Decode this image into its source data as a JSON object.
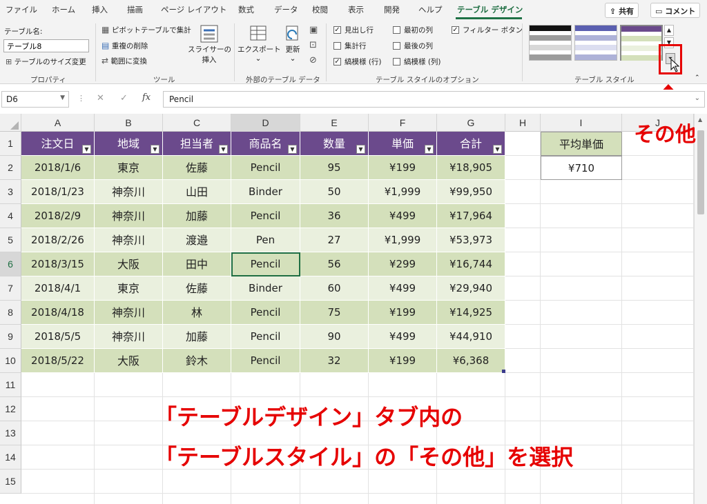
{
  "tabs": [
    "ファイル",
    "ホーム",
    "挿入",
    "描画",
    "ページ レイアウト",
    "数式",
    "データ",
    "校閲",
    "表示",
    "開発",
    "ヘルプ",
    "テーブル デザイン"
  ],
  "share_label": "共有",
  "comment_label": "コメント",
  "ribbon": {
    "properties": {
      "table_name_label": "テーブル名:",
      "table_name_value": "テーブル8",
      "resize_label": "テーブルのサイズ変更",
      "group_label": "プロパティ"
    },
    "tools": {
      "pivot_label": "ピボットテーブルで集計",
      "remove_dup_label": "重複の削除",
      "convert_label": "範囲に変換",
      "slicer_label_1": "スライサーの",
      "slicer_label_2": "挿入",
      "group_label": "ツール"
    },
    "external": {
      "export_label": "エクスポート",
      "refresh_label": "更新",
      "group_label": "外部のテーブル データ"
    },
    "options": {
      "header_row": "見出し行",
      "total_row": "集計行",
      "banded_rows": "縞模様 (行)",
      "first_col": "最初の列",
      "last_col": "最後の列",
      "banded_cols": "縞模様 (列)",
      "filter_btn": "フィルター ボタン",
      "group_label": "テーブル スタイルのオプション"
    },
    "styles": {
      "group_label": "テーブル スタイル"
    }
  },
  "formula_bar": {
    "name_box": "D6",
    "cancel_icon": "✕",
    "enter_icon": "✓",
    "fx": "fx",
    "formula": "Pencil"
  },
  "columns": [
    "A",
    "B",
    "C",
    "D",
    "E",
    "F",
    "G",
    "H",
    "I",
    "J"
  ],
  "rows": [
    "1",
    "2",
    "3",
    "4",
    "5",
    "6",
    "7",
    "8",
    "9",
    "10",
    "11",
    "12",
    "13",
    "14",
    "15"
  ],
  "table": {
    "headers": [
      "注文日",
      "地域",
      "担当者",
      "商品名",
      "数量",
      "単価",
      "合計"
    ],
    "rows": [
      [
        "2018/1/6",
        "東京",
        "佐藤",
        "Pencil",
        "95",
        "¥199",
        "¥18,905"
      ],
      [
        "2018/1/23",
        "神奈川",
        "山田",
        "Binder",
        "50",
        "¥1,999",
        "¥99,950"
      ],
      [
        "2018/2/9",
        "神奈川",
        "加藤",
        "Pencil",
        "36",
        "¥499",
        "¥17,964"
      ],
      [
        "2018/2/26",
        "神奈川",
        "渡邉",
        "Pen",
        "27",
        "¥1,999",
        "¥53,973"
      ],
      [
        "2018/3/15",
        "大阪",
        "田中",
        "Pencil",
        "56",
        "¥299",
        "¥16,744"
      ],
      [
        "2018/4/1",
        "東京",
        "佐藤",
        "Binder",
        "60",
        "¥499",
        "¥29,940"
      ],
      [
        "2018/4/18",
        "神奈川",
        "林",
        "Pencil",
        "75",
        "¥199",
        "¥14,925"
      ],
      [
        "2018/5/5",
        "神奈川",
        "加藤",
        "Pencil",
        "90",
        "¥499",
        "¥44,910"
      ],
      [
        "2018/5/22",
        "大阪",
        "鈴木",
        "Pencil",
        "32",
        "¥199",
        "¥6,368"
      ]
    ]
  },
  "avg_price": {
    "label": "平均単価",
    "value": "¥710"
  },
  "annotations": {
    "callout": "その他",
    "line1": "「テーブルデザイン」タブ内の",
    "line2": "「テーブルスタイル」の「その他」を選択"
  },
  "colors": {
    "accent": "#1e7145",
    "table_header": "#6b4a8c",
    "band_dark": "#d4e0bb",
    "band_light": "#eaf0de",
    "annotation": "#e60000"
  }
}
